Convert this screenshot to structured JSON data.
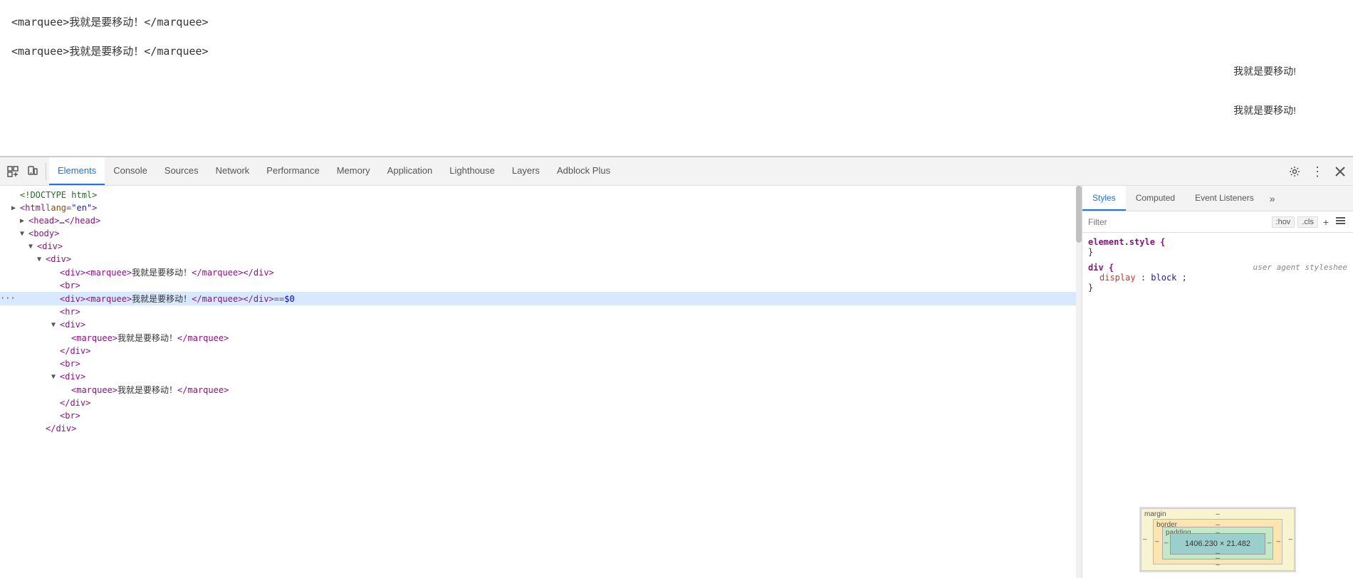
{
  "main_content": {
    "marquee_code_1": "<marquee>我就是要移动！</marquee>",
    "marquee_code_2": "<marquee>我就是要移动！</marquee>",
    "marquee_rendered_1": "我就是要移动!",
    "marquee_rendered_2": "我就是要移动!"
  },
  "devtools": {
    "tabs": [
      {
        "id": "elements",
        "label": "Elements",
        "active": true
      },
      {
        "id": "console",
        "label": "Console",
        "active": false
      },
      {
        "id": "sources",
        "label": "Sources",
        "active": false
      },
      {
        "id": "network",
        "label": "Network",
        "active": false
      },
      {
        "id": "performance",
        "label": "Performance",
        "active": false
      },
      {
        "id": "memory",
        "label": "Memory",
        "active": false
      },
      {
        "id": "application",
        "label": "Application",
        "active": false
      },
      {
        "id": "lighthouse",
        "label": "Lighthouse",
        "active": false
      },
      {
        "id": "layers",
        "label": "Layers",
        "active": false
      },
      {
        "id": "adblock",
        "label": "Adblock Plus",
        "active": false
      }
    ]
  },
  "dom_panel": {
    "lines": [
      {
        "indent": 0,
        "triangle": "",
        "content": "<!DOCTYPE html>",
        "type": "doctype"
      },
      {
        "indent": 0,
        "triangle": "▶",
        "content": "<html lang=\"en\">",
        "type": "open"
      },
      {
        "indent": 1,
        "triangle": "▶",
        "content": "<head>…</head>",
        "type": "collapsed"
      },
      {
        "indent": 1,
        "triangle": "▼",
        "content": "<body>",
        "type": "open"
      },
      {
        "indent": 2,
        "triangle": "▼",
        "content": "<div>",
        "type": "open"
      },
      {
        "indent": 3,
        "triangle": "▼",
        "content": "<div>",
        "type": "open"
      },
      {
        "indent": 4,
        "triangle": "",
        "content": "<div><marquee>我就是要移动！</marquee></div>",
        "type": "leaf"
      },
      {
        "indent": 4,
        "triangle": "",
        "content": "<br>",
        "type": "leaf"
      },
      {
        "indent": 4,
        "triangle": "",
        "content": "<div><marquee>我就是要移动！</marquee></div>  ==  $0",
        "type": "leaf",
        "selected": true
      },
      {
        "indent": 4,
        "triangle": "",
        "content": "<hr>",
        "type": "leaf"
      },
      {
        "indent": 4,
        "triangle": "▼",
        "content": "<div>",
        "type": "open"
      },
      {
        "indent": 5,
        "triangle": "",
        "content": "<marquee>我就是要移动！</marquee>",
        "type": "leaf"
      },
      {
        "indent": 4,
        "triangle": "",
        "content": "</div>",
        "type": "close"
      },
      {
        "indent": 4,
        "triangle": "",
        "content": "<br>",
        "type": "leaf"
      },
      {
        "indent": 4,
        "triangle": "▼",
        "content": "<div>",
        "type": "open"
      },
      {
        "indent": 5,
        "triangle": "",
        "content": "<marquee>我就是要移动！</marquee>",
        "type": "leaf"
      },
      {
        "indent": 4,
        "triangle": "",
        "content": "</div>",
        "type": "close"
      },
      {
        "indent": 4,
        "triangle": "",
        "content": "<br>",
        "type": "leaf"
      },
      {
        "indent": 3,
        "triangle": "",
        "content": "</div>",
        "type": "close"
      }
    ]
  },
  "right_panel": {
    "tabs": [
      {
        "id": "styles",
        "label": "Styles",
        "active": true
      },
      {
        "id": "computed",
        "label": "Computed",
        "active": false
      },
      {
        "id": "event-listeners",
        "label": "Event Listeners",
        "active": false
      }
    ],
    "filter": {
      "placeholder": "Filter",
      "hov_label": ":hov",
      "cls_label": ".cls"
    },
    "styles": {
      "rules": [
        {
          "selector": "element.style {",
          "close": "}",
          "properties": []
        },
        {
          "selector": "div {",
          "source": "user agent styleshee",
          "close": "}",
          "properties": [
            {
              "name": "display",
              "value": "block",
              "color": "#c0392b"
            }
          ]
        }
      ]
    },
    "box_model": {
      "title": "margin",
      "border_label": "border",
      "padding_label": "padding",
      "margin_dash": "–",
      "border_dash": "–",
      "padding_dash": "–",
      "content_size": "1406.230 × 21.482",
      "margin_values": {
        "top": "–",
        "bottom": "–",
        "left": "–",
        "right": "–"
      },
      "border_values": {
        "top": "–",
        "bottom": "–",
        "left": "–",
        "right": "–"
      },
      "padding_values": {
        "top": "–",
        "bottom": "–",
        "left": "–",
        "right": "–"
      }
    }
  }
}
